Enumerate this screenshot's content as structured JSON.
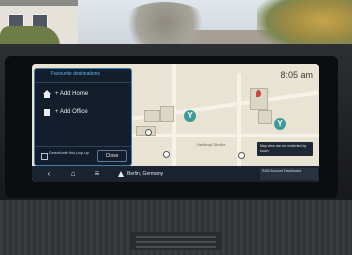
{
  "screen": {
    "clock": "8:05 am",
    "favorites_panel": {
      "title": "Favourite destinations",
      "items": [
        {
          "label": "+ Add Home",
          "icon": "home-icon"
        },
        {
          "label": "+ Add Office",
          "icon": "office-icon"
        }
      ],
      "deactivate_label": "Deactivate this pop-up",
      "close_label": "Close"
    },
    "map": {
      "street_label": "Hartkopf-Straße",
      "hint": "Map view can be restricted by touch",
      "accent": "#3f9b9a"
    },
    "navbar": {
      "back_icon": "chevron-left-icon",
      "home_icon": "home-icon",
      "menu_icon": "menu-icon",
      "location": "Berlin, Germany",
      "right_info": "SAM Account Dashboard"
    }
  }
}
